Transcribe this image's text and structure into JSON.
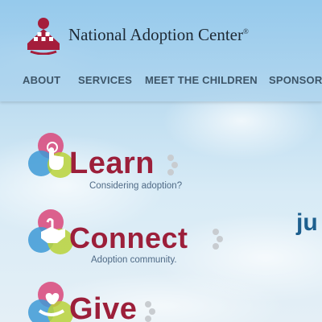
{
  "header": {
    "logo_text": "National Adoption Center",
    "logo_mark": "®"
  },
  "nav": {
    "items": [
      "ABOUT",
      "SERVICES",
      "MEET THE CHILDREN",
      "SPONSORS"
    ]
  },
  "sections": [
    {
      "title": "Learn",
      "subtitle": "Considering adoption?",
      "icon": "pointer-hand-icon"
    },
    {
      "title": "Connect",
      "subtitle": "Adoption community.",
      "icon": "handshake-icon"
    },
    {
      "title": "Give",
      "subtitle": "",
      "icon": "heart-hand-icon"
    }
  ],
  "side_text": "ju",
  "colors": {
    "brand_red": "#9c1f3a",
    "nav_text": "#3d5568",
    "subtitle": "#4f6a86",
    "pink": "#d9467a",
    "blue": "#3e9ad6",
    "green": "#b9d23a"
  }
}
